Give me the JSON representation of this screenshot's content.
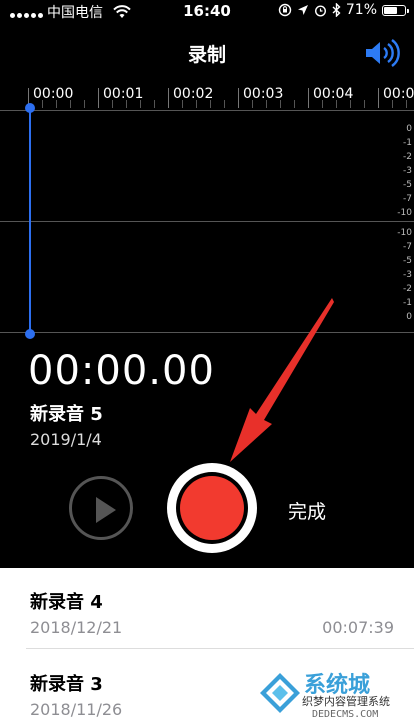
{
  "status_bar": {
    "carrier": "中国电信",
    "time": "16:40",
    "battery": "71%",
    "battery_level": 0.71
  },
  "nav": {
    "title": "录制",
    "speaker_icon": "speaker-icon"
  },
  "timeline": {
    "ticks": [
      "00:00",
      "00:01",
      "00:02",
      "00:03",
      "00:04",
      "00:0"
    ]
  },
  "waveform": {
    "db_top": [
      "0",
      "-1",
      "-2",
      "-3",
      "-5",
      "-7",
      "-10"
    ],
    "db_bottom": [
      "-10",
      "-7",
      "-5",
      "-3",
      "-2",
      "-1",
      "0"
    ]
  },
  "recorder": {
    "timer": "00:00.00",
    "name": "新录音 5",
    "date": "2019/1/4",
    "done_label": "完成"
  },
  "recordings": [
    {
      "title": "新录音 4",
      "date": "2018/12/21",
      "duration": "00:07:39"
    },
    {
      "title": "新录音 3",
      "date": "2018/11/26",
      "duration": ""
    }
  ],
  "watermark": {
    "title": "系统城",
    "subtitle": "织梦内容管理系统",
    "url": "DEDECMS.COM"
  },
  "colors": {
    "accent_blue": "#2d6ff0",
    "record_red": "#f23a2f",
    "arrow_red": "#e8302a"
  }
}
